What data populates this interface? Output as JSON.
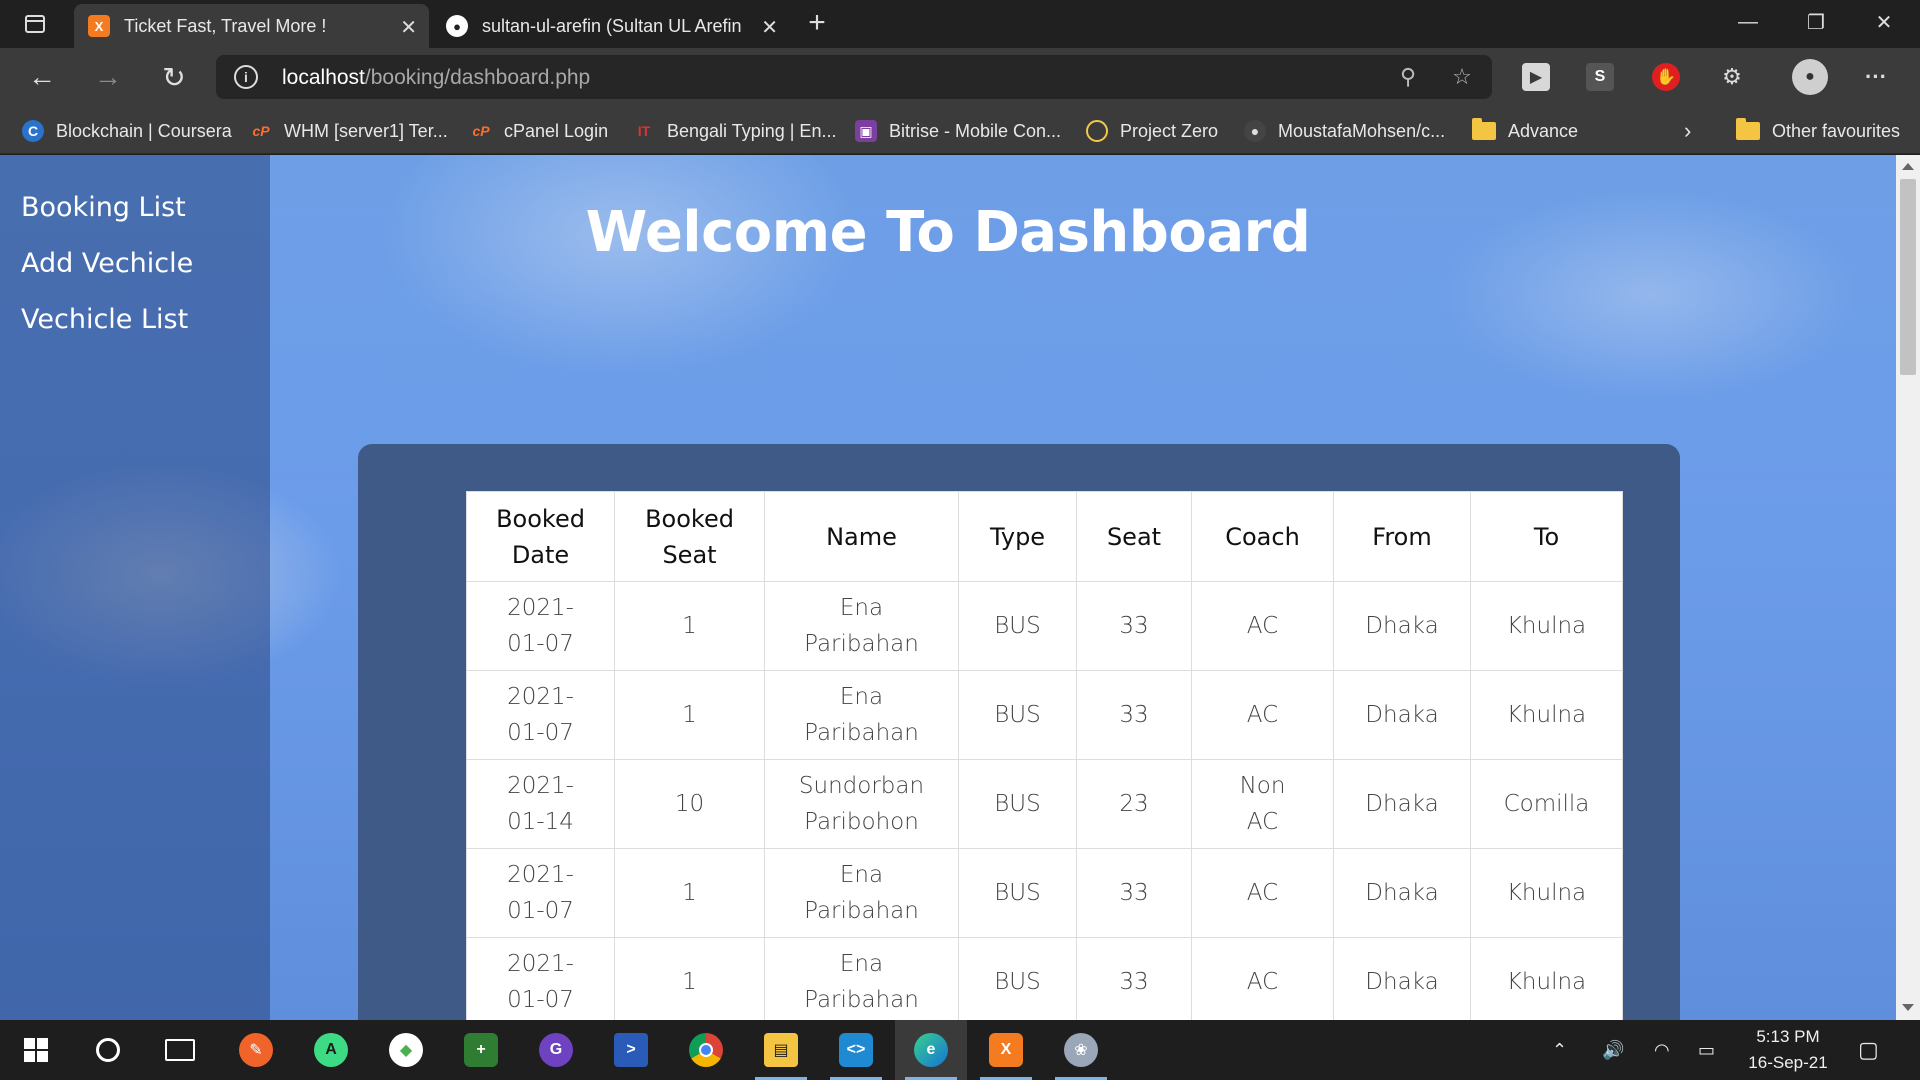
{
  "browser": {
    "tabs": [
      {
        "title": "Ticket Fast, Travel More !",
        "active": true,
        "favicon": "xampp-icon"
      },
      {
        "title": "sultan-ul-arefin (Sultan UL Arefin",
        "active": false,
        "favicon": "github-icon"
      }
    ],
    "address": {
      "host": "localhost",
      "path": "/booking/dashboard.php"
    },
    "bookmarks": [
      {
        "label": "Blockchain | Coursera",
        "icon": "coursera-icon",
        "color": "#2a73cc"
      },
      {
        "label": "WHM [server1] Ter...",
        "icon": "cpanel-icon",
        "color": "#ff6c2c"
      },
      {
        "label": "cPanel Login",
        "icon": "cpanel-icon",
        "color": "#ff6c2c"
      },
      {
        "label": "Bengali Typing | En...",
        "icon": "typing-icon",
        "color": "#e03131"
      },
      {
        "label": "Bitrise - Mobile Con...",
        "icon": "bitrise-icon",
        "color": "#7b3fa0"
      },
      {
        "label": "Project Zero",
        "icon": "circle-icon",
        "color": "#f2c94c"
      },
      {
        "label": "MoustafaMohsen/c...",
        "icon": "github-icon",
        "color": "#444444"
      },
      {
        "label": "Advance",
        "icon": "folder-icon",
        "color": "#f4c542"
      }
    ],
    "other_favourites": "Other favourites"
  },
  "sidebar": {
    "links": [
      "Booking List",
      "Add Vechicle",
      "Vechicle List"
    ]
  },
  "page": {
    "title": "Welcome To Dashboard"
  },
  "table": {
    "headers": [
      [
        "Booked",
        "Date"
      ],
      [
        "Booked",
        "Seat"
      ],
      [
        "Name"
      ],
      [
        "Type"
      ],
      [
        "Seat"
      ],
      [
        "Coach"
      ],
      [
        "From"
      ],
      [
        "To"
      ]
    ],
    "rows": [
      [
        [
          "2021-",
          "01-07"
        ],
        [
          "1"
        ],
        [
          "Ena",
          "Paribahan"
        ],
        [
          "BUS"
        ],
        [
          "33"
        ],
        [
          "AC"
        ],
        [
          "Dhaka"
        ],
        [
          "Khulna"
        ]
      ],
      [
        [
          "2021-",
          "01-07"
        ],
        [
          "1"
        ],
        [
          "Ena",
          "Paribahan"
        ],
        [
          "BUS"
        ],
        [
          "33"
        ],
        [
          "AC"
        ],
        [
          "Dhaka"
        ],
        [
          "Khulna"
        ]
      ],
      [
        [
          "2021-",
          "01-14"
        ],
        [
          "10"
        ],
        [
          "Sundorban",
          "Paribohon"
        ],
        [
          "BUS"
        ],
        [
          "23"
        ],
        [
          "Non",
          "AC"
        ],
        [
          "Dhaka"
        ],
        [
          "Comilla"
        ]
      ],
      [
        [
          "2021-",
          "01-07"
        ],
        [
          "1"
        ],
        [
          "Ena",
          "Paribahan"
        ],
        [
          "BUS"
        ],
        [
          "33"
        ],
        [
          "AC"
        ],
        [
          "Dhaka"
        ],
        [
          "Khulna"
        ]
      ],
      [
        [
          "2021-",
          "01-07"
        ],
        [
          "1"
        ],
        [
          "Ena",
          "Paribahan"
        ],
        [
          "BUS"
        ],
        [
          "33"
        ],
        [
          "AC"
        ],
        [
          "Dhaka"
        ],
        [
          "Khulna"
        ]
      ]
    ]
  },
  "taskbar": {
    "apps": [
      {
        "name": "paint-icon",
        "color": "#f0632a",
        "glyph": "✎"
      },
      {
        "name": "android-studio-icon",
        "color": "#3ddc84",
        "glyph": "A"
      },
      {
        "name": "mongodb-icon",
        "color": "#4caf50",
        "glyph": "◆"
      },
      {
        "name": "security-icon",
        "color": "#2e7d32",
        "glyph": "+"
      },
      {
        "name": "github-desktop-icon",
        "color": "#6f42c1",
        "glyph": "G"
      },
      {
        "name": "powershell-icon",
        "color": "#2a5bb8",
        "glyph": ">"
      },
      {
        "name": "chrome-icon",
        "color": "#db4437",
        "glyph": "●"
      },
      {
        "name": "file-explorer-icon",
        "color": "#f4c542",
        "glyph": "▤"
      },
      {
        "name": "vscode-icon",
        "color": "#1f8ad2",
        "glyph": "<>"
      },
      {
        "name": "edge-icon",
        "color": "#1ea0c8",
        "glyph": "e"
      },
      {
        "name": "xampp-icon",
        "color": "#f47b20",
        "glyph": "X"
      },
      {
        "name": "paint3d-icon",
        "color": "#9aa7b8",
        "glyph": "❀"
      }
    ],
    "time": "5:13 PM",
    "date": "16-Sep-21"
  }
}
